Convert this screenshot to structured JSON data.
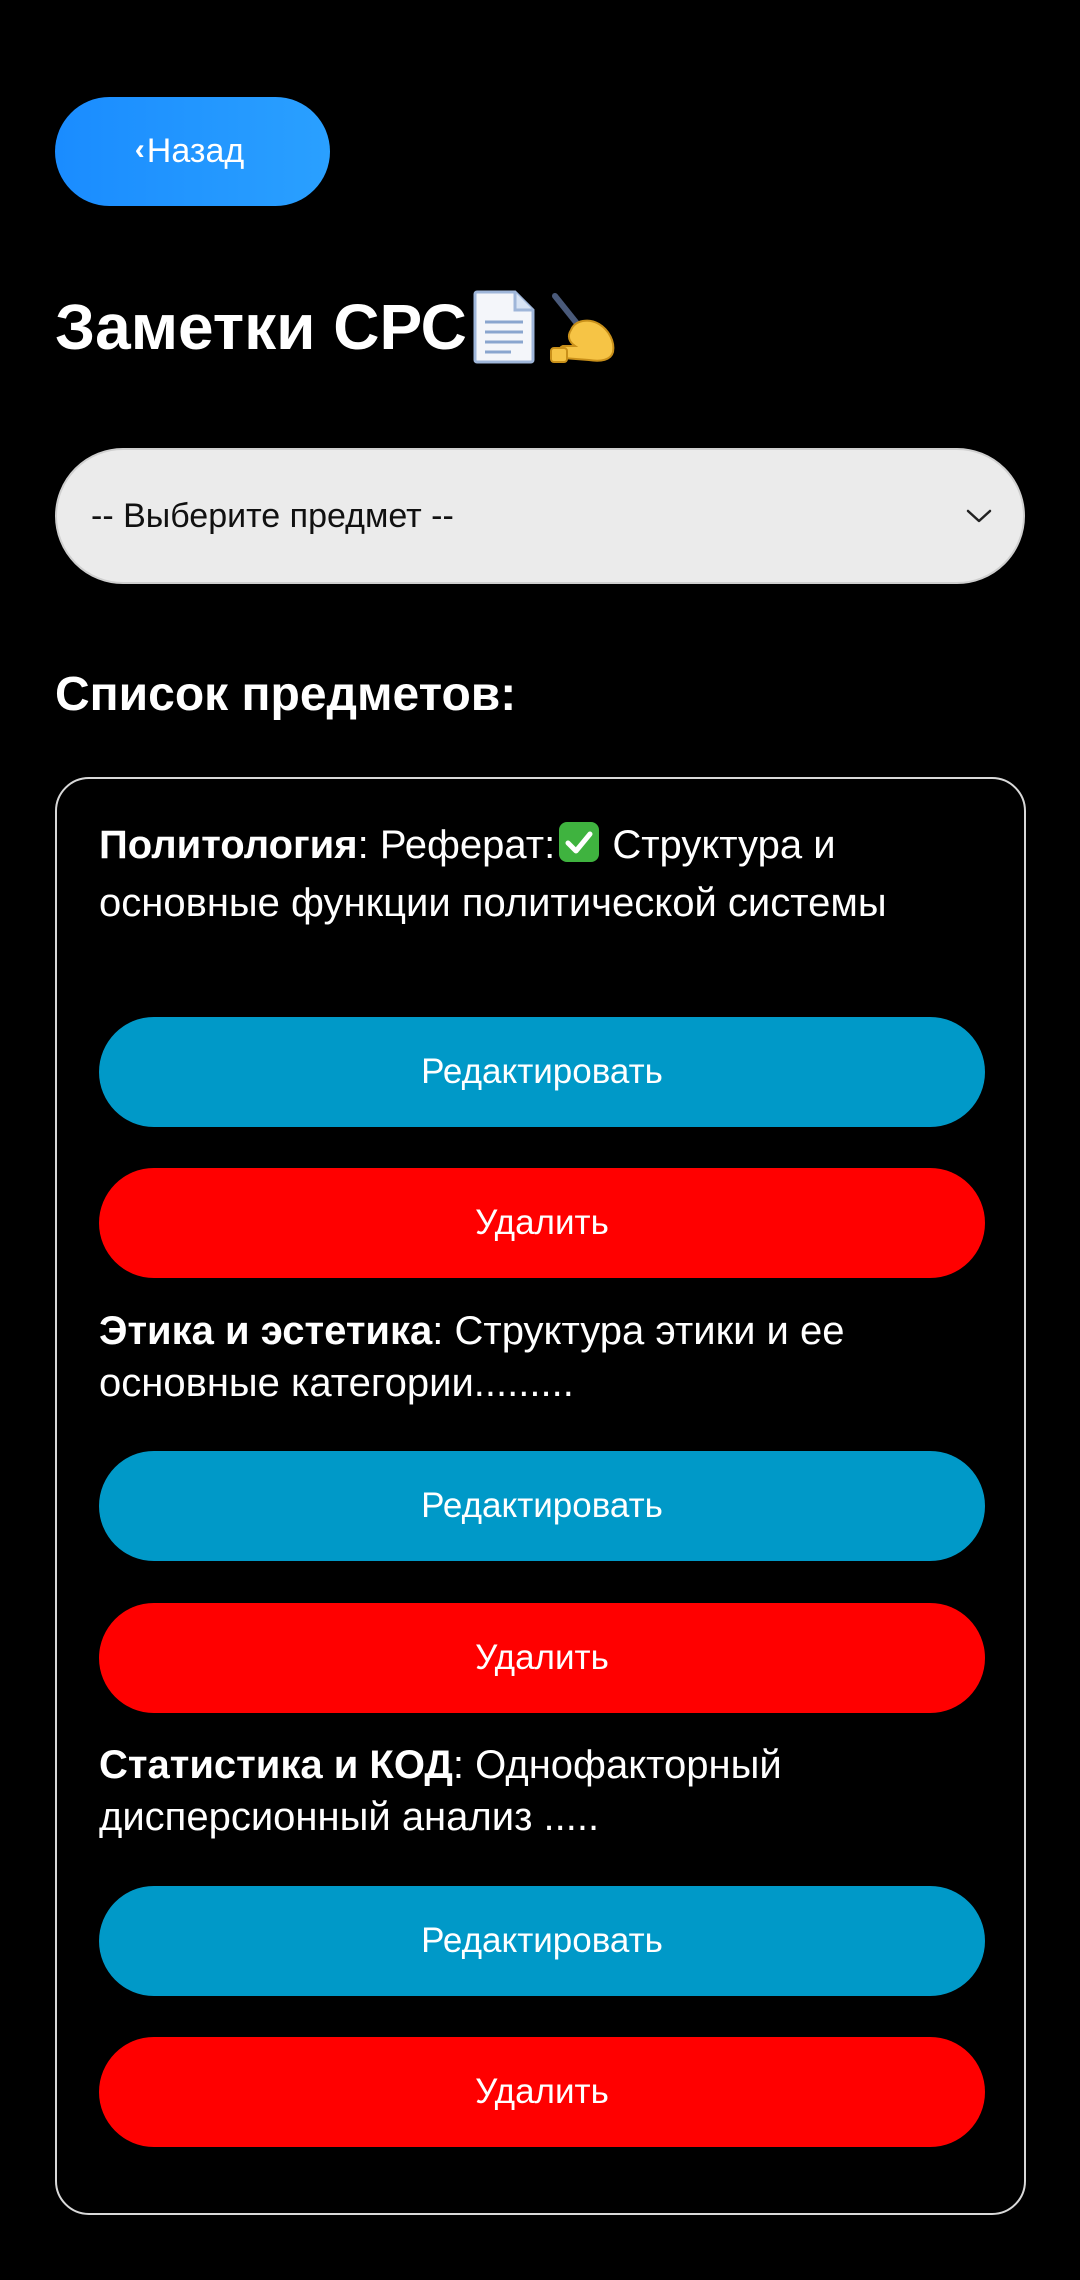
{
  "header": {
    "back_label": "Назад",
    "title": "Заметки СРС",
    "title_icons": [
      "document-icon",
      "writing-hand-icon"
    ]
  },
  "select": {
    "value": "-- Выберите предмет --",
    "icon": "chevron-down-icon"
  },
  "list": {
    "heading": "Список предметов:",
    "items": [
      {
        "subject": "Политология",
        "note_prefix": " Реферат:",
        "note_icon": "check-mark-icon",
        "note_text": " Структура и основные функции политической системы",
        "edit_label": "Редактировать",
        "delete_label": "Удалить"
      },
      {
        "subject": "Этика и эстетика",
        "note_prefix": "",
        "note_icon": "",
        "note_text": " Структура этики и ее основные категории.........",
        "edit_label": "Редактировать",
        "delete_label": "Удалить"
      },
      {
        "subject": "Статистика и КОД",
        "note_prefix": "",
        "note_icon": "",
        "note_text": " Однофакторный дисперсионный анализ .....",
        "edit_label": "Редактировать",
        "delete_label": "Удалить"
      }
    ]
  },
  "colors": {
    "background": "#000000",
    "back_button": "#1a8cff",
    "edit_button": "#0099c8",
    "delete_button": "#ff0000",
    "select_bg": "#ebebeb",
    "card_border": "#d9d9d9"
  }
}
